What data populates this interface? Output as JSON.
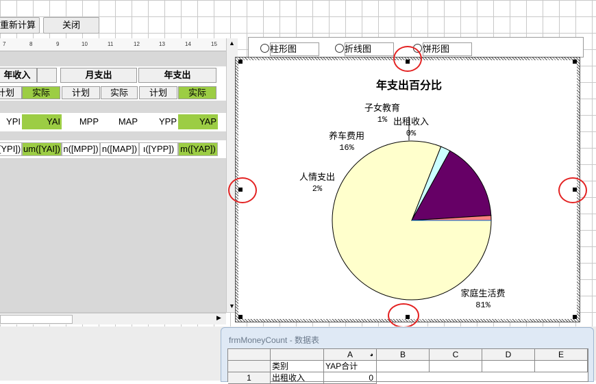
{
  "toolbar": {
    "recalc_label": "重新计算",
    "close_label": "关闭"
  },
  "ruler": {
    "marks": [
      "7",
      "8",
      "9",
      "10",
      "11",
      "12",
      "13",
      "14",
      "15"
    ]
  },
  "form": {
    "groups": [
      "年收入",
      "月支出",
      "年支出"
    ],
    "sub_labels": [
      "计划",
      "实际",
      "计划",
      "实际",
      "计划",
      "实际"
    ],
    "fields": [
      "YPI",
      "YAI",
      "MPP",
      "MAP",
      "YPP",
      "YAP"
    ],
    "sums": [
      "[YPI])",
      "um([YAI])",
      "n([MPP])",
      "n([MAP])",
      "ı([YPP])",
      "m([YAP])"
    ]
  },
  "chart_type_options": [
    "柱形图",
    "折线图",
    "饼形图"
  ],
  "chart_data": {
    "type": "pie",
    "title": "年支出百分比",
    "slices": [
      {
        "label": "家庭生活费",
        "percent_label": "81%",
        "value": 81,
        "color": "#ffffcc"
      },
      {
        "label": "人情支出",
        "percent_label": "2%",
        "value": 2,
        "color": "#ccffff"
      },
      {
        "label": "养车费用",
        "percent_label": "16%",
        "value": 16,
        "color": "#660066"
      },
      {
        "label": "子女教育",
        "percent_label": "1%",
        "value": 1,
        "color": "#ff8080"
      },
      {
        "label": "出租收入",
        "percent_label": "0%",
        "value": 0,
        "color": "#0066cc"
      }
    ]
  },
  "datasheet": {
    "title": "frmMoneyCount - 数据表",
    "columns": [
      "A",
      "B",
      "C",
      "D",
      "E"
    ],
    "row_label": "类别",
    "col_a_header": "YAP合计",
    "rows": [
      {
        "num": "1",
        "label": "出租收入",
        "value": "0"
      }
    ]
  }
}
